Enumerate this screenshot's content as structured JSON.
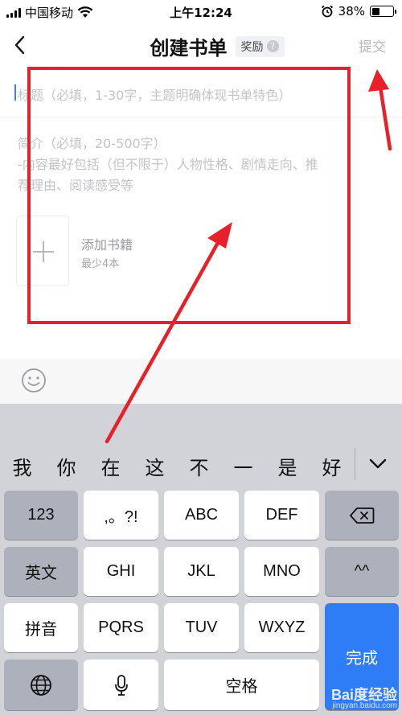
{
  "status_bar": {
    "carrier": "中国移动",
    "time": "上午12:24",
    "battery_text": "38%",
    "battery_level": 0.38,
    "icons": [
      "signal-icon",
      "wifi-icon",
      "alarm-icon",
      "battery-icon"
    ]
  },
  "nav": {
    "back_icon": "chevron-left-icon",
    "title": "创建书单",
    "reward_label": "奖励",
    "reward_help_icon": "?",
    "submit_label": "提交"
  },
  "form": {
    "title_placeholder": "标题（必填，1-30字，主题明确体现书单特色）",
    "intro_lines": [
      "简介（必填，20-500字）",
      "-内容最好包括（但不限于）人物性格、剧情走向、推",
      "荐理由、阅读感受等"
    ],
    "add_book_label": "添加书籍",
    "add_book_hint": "最少4本",
    "emoji_icon": "emoji-icon"
  },
  "keyboard": {
    "candidates": [
      "我",
      "你",
      "在",
      "这",
      "不",
      "一",
      "是",
      "好"
    ],
    "row1": [
      "123",
      ",。?!",
      "ABC",
      "DEF",
      "⌫"
    ],
    "row2": [
      "英文",
      "GHI",
      "JKL",
      "MNO",
      "^^"
    ],
    "row3": [
      "拼音",
      "PQRS",
      "TUV",
      "WXYZ"
    ],
    "row4": [
      "globe-icon",
      "mic-icon",
      "空格"
    ],
    "done_label": "完成"
  },
  "colors": {
    "accent_blue": "#2f7df6",
    "annotation_red": "#e8202a",
    "placeholder_gray": "#c3c4c7"
  },
  "watermark": {
    "main": "Bai度经验",
    "sub": "jingyan.baidu.com"
  }
}
